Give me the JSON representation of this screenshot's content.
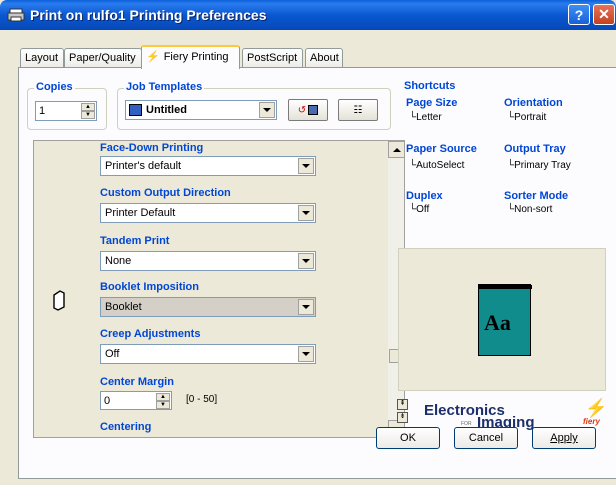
{
  "window": {
    "title": "Print on rulfo1 Printing Preferences",
    "help_label": "?",
    "close_label": "✕"
  },
  "tabs": [
    {
      "label": "Layout"
    },
    {
      "label": "Paper/Quality"
    },
    {
      "label": "Fiery Printing",
      "active": true
    },
    {
      "label": "PostScript"
    },
    {
      "label": "About"
    }
  ],
  "copies": {
    "label": "Copies",
    "value": "1"
  },
  "job_templates": {
    "label": "Job Templates",
    "value": "Untitled"
  },
  "settings": [
    {
      "label": "Face-Down Printing",
      "value": "Printer's default"
    },
    {
      "label": "Custom Output Direction",
      "value": "Printer Default"
    },
    {
      "label": "Tandem Print",
      "value": "None"
    },
    {
      "label": "Booklet Imposition",
      "value": "Booklet"
    },
    {
      "label": "Creep Adjustments",
      "value": "Off"
    },
    {
      "label": "Center Margin",
      "value": "0",
      "range": "[0 - 50]"
    },
    {
      "label": "Centering"
    }
  ],
  "shortcuts": {
    "label": "Shortcuts",
    "items": [
      {
        "label": "Page Size",
        "value": "Letter"
      },
      {
        "label": "Orientation",
        "value": "Portrait"
      },
      {
        "label": "Paper Source",
        "value": "AutoSelect"
      },
      {
        "label": "Output Tray",
        "value": "Primary Tray"
      },
      {
        "label": "Duplex",
        "value": "Off"
      },
      {
        "label": "Sorter Mode",
        "value": "Non-sort"
      }
    ]
  },
  "preview": {
    "text": "Aa"
  },
  "brand": {
    "line1": "Electronics",
    "for": "FOR",
    "line2": "Imaging",
    "fiery": "fiery"
  },
  "buttons": {
    "ok": "OK",
    "cancel": "Cancel",
    "apply": "Apply"
  },
  "colors": {
    "accent": "#0046d5",
    "preview_page": "#118c8c",
    "titlebar": "#0a58d0"
  }
}
